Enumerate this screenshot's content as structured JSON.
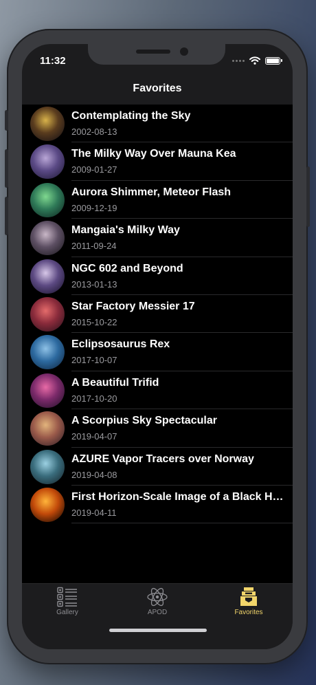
{
  "status_bar": {
    "time": "11:32"
  },
  "nav": {
    "title": "Favorites"
  },
  "favorites": [
    {
      "title": "Contemplating the Sky",
      "date": "2002-08-13",
      "thumb": [
        "#d8b24a",
        "#5a3c1e",
        "#0d0b14"
      ]
    },
    {
      "title": "The Milky Way Over Mauna Kea",
      "date": "2009-01-27",
      "thumb": [
        "#b9a6d6",
        "#5b4a86",
        "#1a1530"
      ]
    },
    {
      "title": "Aurora Shimmer, Meteor Flash",
      "date": "2009-12-19",
      "thumb": [
        "#7fd88f",
        "#2f7a58",
        "#0b1f1c"
      ]
    },
    {
      "title": "Mangaia's Milky Way",
      "date": "2011-09-24",
      "thumb": [
        "#c9b7c7",
        "#5d4f63",
        "#161418"
      ]
    },
    {
      "title": "NGC 602 and Beyond",
      "date": "2013-01-13",
      "thumb": [
        "#d7c7e8",
        "#5d4a83",
        "#120c22"
      ]
    },
    {
      "title": "Star Factory Messier 17",
      "date": "2015-10-22",
      "thumb": [
        "#e46b6b",
        "#8a2b3b",
        "#24101a"
      ]
    },
    {
      "title": "Eclipsosaurus Rex",
      "date": "2017-10-07",
      "thumb": [
        "#8ec1e6",
        "#2d6aa0",
        "#0c213a"
      ]
    },
    {
      "title": "A Beautiful Trifid",
      "date": "2017-10-20",
      "thumb": [
        "#e86aa6",
        "#7b2a6a",
        "#1b0f24"
      ]
    },
    {
      "title": "A Scorpius Sky Spectacular",
      "date": "2019-04-07",
      "thumb": [
        "#e2b47c",
        "#9a5a4a",
        "#281a24"
      ]
    },
    {
      "title": "AZURE Vapor Tracers over Norway",
      "date": "2019-04-08",
      "thumb": [
        "#9bd0e2",
        "#3a6d7d",
        "#131d22"
      ]
    },
    {
      "title": "First Horizon-Scale Image of a Black Hole",
      "date": "2019-04-11",
      "thumb": [
        "#ffb43a",
        "#c24a0a",
        "#000000"
      ]
    }
  ],
  "tabs": [
    {
      "label": "Gallery",
      "icon": "gallery-icon",
      "active": false
    },
    {
      "label": "APOD",
      "icon": "atom-icon",
      "active": false
    },
    {
      "label": "Favorites",
      "icon": "favorites-box-icon",
      "active": true
    }
  ],
  "colors": {
    "accent": "#f2d56b",
    "list_bg": "#000000",
    "bar_bg": "#1c1c1e"
  }
}
